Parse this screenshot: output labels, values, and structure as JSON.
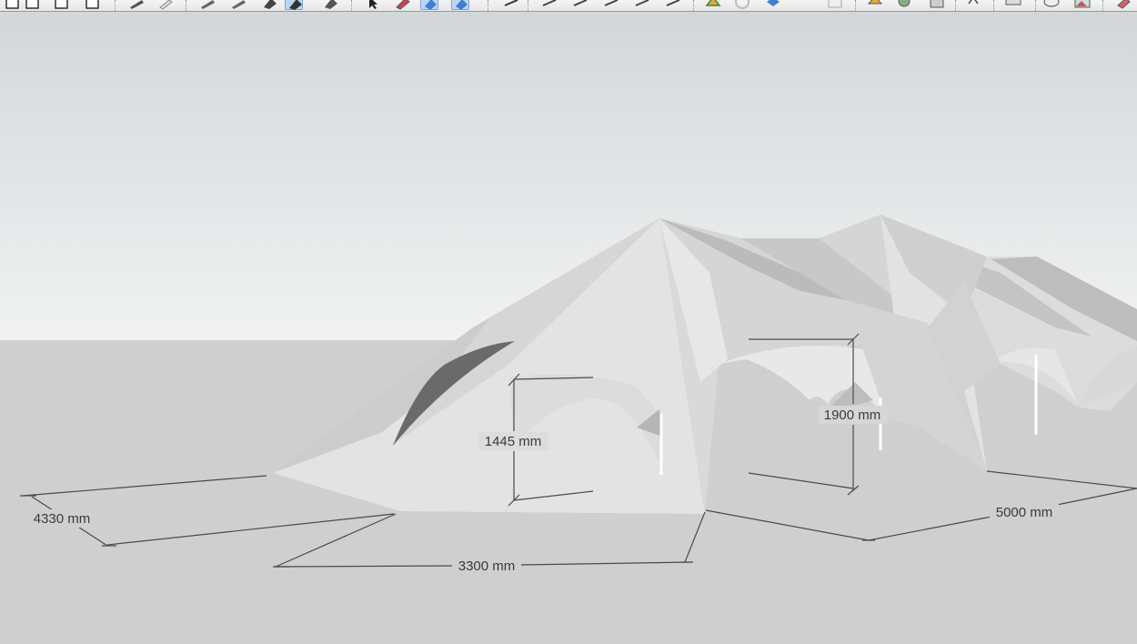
{
  "toolbar": {
    "buttons": [
      {
        "icon": "rectangle-icon"
      },
      {
        "icon": "rectangle-icon"
      },
      {
        "icon": "rectangle-icon"
      },
      {
        "icon": "rectangle-icon"
      },
      {
        "icon": "pencil-icon"
      },
      {
        "icon": "eraser-icon"
      },
      {
        "icon": "pencil-icon"
      },
      {
        "icon": "pencil-icon"
      },
      {
        "icon": "paint-bucket-icon"
      },
      {
        "icon": "paint-bucket-icon",
        "active": true
      },
      {
        "icon": "paint-bucket-icon"
      },
      {
        "icon": "select-arrow-icon"
      },
      {
        "icon": "offset-icon"
      },
      {
        "icon": "view-iso-icon",
        "active": true
      },
      {
        "icon": "view-iso-icon",
        "active": true
      },
      {
        "icon": "dimension-icon"
      },
      {
        "icon": "tape-measure-icon"
      },
      {
        "icon": "protractor-icon"
      },
      {
        "icon": "text-icon"
      },
      {
        "icon": "axes-icon"
      },
      {
        "icon": "section-plane-icon"
      },
      {
        "icon": "orbit-icon"
      },
      {
        "icon": "pan-icon"
      },
      {
        "icon": "box-icon"
      },
      {
        "icon": "camera-icon"
      },
      {
        "icon": "warehouse-icon"
      },
      {
        "icon": "extension-icon"
      },
      {
        "icon": "camera-icon"
      },
      {
        "icon": "walk-icon"
      },
      {
        "icon": "look-around-icon"
      },
      {
        "icon": "position-camera-icon"
      },
      {
        "icon": "comment-icon"
      },
      {
        "icon": "image-icon"
      },
      {
        "icon": "paint-icon"
      }
    ]
  },
  "viewport": {
    "dimensions": [
      {
        "id": "dim-4330",
        "label": "4330 mm"
      },
      {
        "id": "dim-3300",
        "label": "3300 mm"
      },
      {
        "id": "dim-1445",
        "label": "1445 mm"
      },
      {
        "id": "dim-1900",
        "label": "1900 mm"
      },
      {
        "id": "dim-5000",
        "label": "5000 mm"
      }
    ]
  },
  "colors": {
    "sky_top": "#d2d7da",
    "sky_bottom": "#f1f2f2",
    "ground": "#cfcfcf",
    "tent_light": "#e4e4e4",
    "tent_mid": "#d0d0d0",
    "tent_dark": "#b2b2b2",
    "tent_shadow": "#6a6a6a",
    "dimension_line": "#4a4a4a"
  }
}
